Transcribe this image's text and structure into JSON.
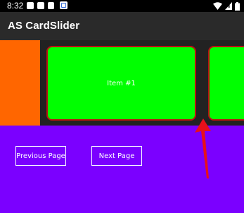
{
  "status_bar": {
    "time": "8:32",
    "icons": [
      "notification-icon",
      "notification-icon",
      "notification-icon",
      "notification-icon",
      "wifi-icon",
      "signal-icon",
      "battery-icon"
    ]
  },
  "app_bar": {
    "title": "AS CardSlider"
  },
  "slider": {
    "cards": [
      {
        "label": "Item #1"
      },
      {
        "label": ""
      }
    ]
  },
  "controls": {
    "previous_label": "Previous Page",
    "next_label": "Next Page"
  },
  "colors": {
    "page_background": "#7b00ff",
    "slider_background": "#222222",
    "side_panel": "#ff6600",
    "card_fill": "#00ff00",
    "card_border": "#bb1111",
    "annotation_arrow": "#e8101a"
  }
}
